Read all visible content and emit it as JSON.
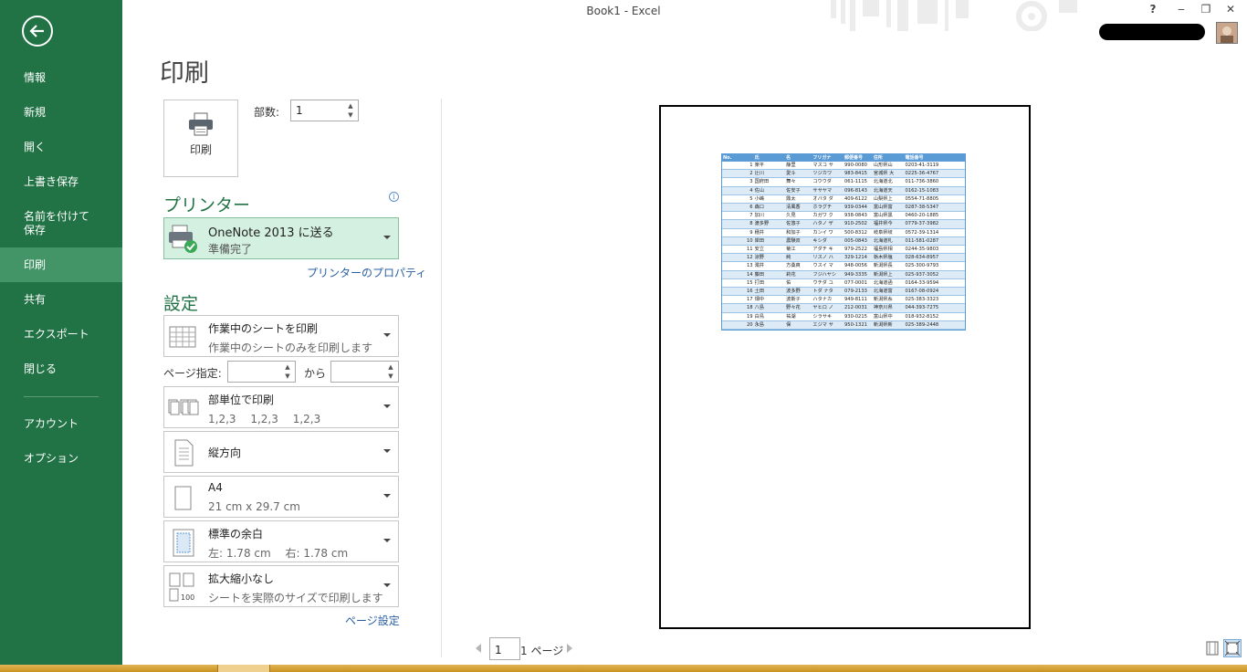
{
  "window": {
    "title": "Book1 - Excel",
    "help": "?",
    "minimize": "‒",
    "restore": "❐",
    "close": "✕"
  },
  "sidebar": {
    "items": [
      {
        "label": "情報"
      },
      {
        "label": "新規"
      },
      {
        "label": "開く"
      },
      {
        "label": "上書き保存"
      },
      {
        "label": "名前を付けて\n保存"
      },
      {
        "label": "印刷",
        "active": true
      },
      {
        "label": "共有"
      },
      {
        "label": "エクスポート"
      },
      {
        "label": "閉じる"
      },
      {
        "label": "アカウント"
      },
      {
        "label": "オプション"
      }
    ]
  },
  "main": {
    "title": "印刷",
    "print_button": "印刷",
    "copies_label": "部数:",
    "copies_value": "1",
    "printer_heading": "プリンター",
    "printer_name": "OneNote 2013 に送る",
    "printer_status": "準備完了",
    "printer_properties": "プリンターのプロパティ",
    "settings_heading": "設定",
    "sheet_scope": {
      "title": "作業中のシートを印刷",
      "desc": "作業中のシートのみを印刷します"
    },
    "page_range_label": "ページ指定:",
    "page_range_to": "から",
    "collate": {
      "title": "部単位で印刷",
      "desc": "1,2,3　 1,2,3　 1,2,3"
    },
    "orientation": {
      "title": "縦方向"
    },
    "paper": {
      "title": "A4",
      "desc": "21 cm x 29.7 cm"
    },
    "margins": {
      "title": "標準の余白",
      "desc": "左:  1.78 cm　 右:  1.78 cm"
    },
    "scaling": {
      "title": "拡大縮小なし",
      "desc": "シートを実際のサイズで印刷します"
    },
    "page_setup": "ページ設定"
  },
  "preview": {
    "page_current": "1",
    "page_total": "1 ページ",
    "sheet_headers": [
      "No.",
      "氏",
      "名",
      "フリガナ",
      "郵便番号",
      "住所",
      "電話番号"
    ],
    "sheet_rows": [
      [
        "1",
        "楽平",
        "静里",
        "マスコ サ",
        "990-0080",
        "山形県山",
        "0203-41-3119"
      ],
      [
        "2",
        "辻川",
        "愛斗",
        "ツジカワ",
        "983-8415",
        "宮城県 大",
        "0225-36-4767"
      ],
      [
        "3",
        "国府田",
        "舞々",
        "コウウダ",
        "061-1115",
        "北海道北",
        "011-736-3860"
      ],
      [
        "4",
        "佐山",
        "佐安子",
        "ササヤマ",
        "096-8143",
        "北海道天",
        "0162-15-1083"
      ],
      [
        "5",
        "小嶋",
        "鼎太",
        "オバタ ダ",
        "409-6122",
        "山梨県上",
        "0554-71-8805"
      ],
      [
        "6",
        "森口",
        "清風香",
        "ホラグチ",
        "939-0344",
        "富山県富",
        "0287-38-5347"
      ],
      [
        "7",
        "加川",
        "久見",
        "カガワ ク",
        "938-0843",
        "富山県黒",
        "0460-20-1885"
      ],
      [
        "8",
        "渡多野",
        "佐悠子",
        "ハタノ ザ",
        "910-2502",
        "福井県今",
        "0779-37-3982"
      ],
      [
        "9",
        "穗井",
        "和加子",
        "カンイ ワ",
        "500-8312",
        "岐阜県岐",
        "0572-39-1314"
      ],
      [
        "10",
        "岸田",
        "農験双",
        "キシダ",
        "005-0843",
        "北海道札",
        "011-581-0287"
      ],
      [
        "11",
        "安立",
        "菊江",
        "アダチ キ",
        "979-2522",
        "福島県相",
        "0244-35-9803"
      ],
      [
        "12",
        "涼野",
        "純",
        "リスノ ハ",
        "329-1214",
        "栃木県塩",
        "028-634-8957"
      ],
      [
        "13",
        "濁井",
        "方桑爽",
        "ウスイ マ",
        "948-0056",
        "新潟県長",
        "025-300-9793"
      ],
      [
        "14",
        "藤田",
        "莉花",
        "フジハヤシ",
        "949-3335",
        "新潟県上",
        "025-937-3052"
      ],
      [
        "15",
        "打田",
        "佑",
        "ウチダ ユ",
        "077-0001",
        "北海道函",
        "0164-33-9594"
      ],
      [
        "16",
        "土田",
        "波多野",
        "トダ ナタ",
        "079-2133",
        "北海道富",
        "0167-08-0924"
      ],
      [
        "17",
        "畑中",
        "波斯子",
        "ハタナカ",
        "949-8111",
        "新潟県糸",
        "025-383-3323"
      ],
      [
        "18",
        "八島",
        "野々花",
        "ヤヒロ ノ",
        "212-0031",
        "神奈川県",
        "044-393-7275"
      ],
      [
        "19",
        "白鳥",
        "祐湖",
        "シラサキ",
        "930-0215",
        "富山県中",
        "018-932-8152"
      ],
      [
        "20",
        "永島",
        "保",
        "エジマ サ",
        "950-1321",
        "新潟県新",
        "025-389-2448"
      ]
    ]
  },
  "icons": {
    "back": "back-arrow-icon",
    "printer": "printer-icon",
    "sheet": "sheet-grid-icon",
    "collate": "collate-pages-icon",
    "portrait": "portrait-page-icon",
    "paper": "paper-size-icon",
    "margins": "margins-icon",
    "scaling": "no-scaling-icon"
  },
  "colors": {
    "excel_green": "#217346",
    "active_nav": "#439467",
    "printer_box": "#d3f0e0",
    "link_blue": "#2a5ea3",
    "table_header": "#5b9bd5"
  }
}
